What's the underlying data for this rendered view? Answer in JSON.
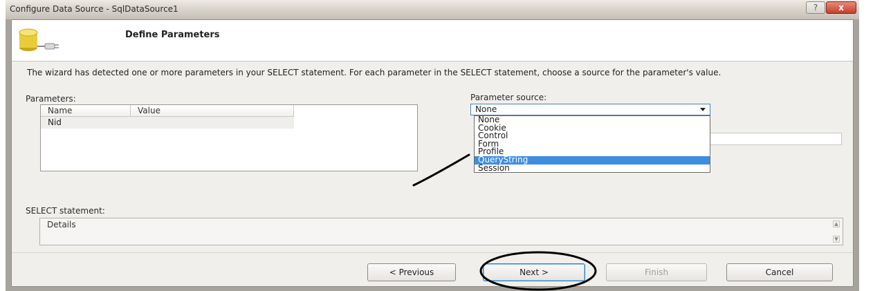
{
  "window": {
    "title": "Configure Data Source - SqlDataSource1",
    "help_glyph": "?",
    "close_glyph": "x"
  },
  "header": {
    "title": "Define Parameters",
    "icon": "database-icon"
  },
  "intro_text": "The wizard has detected one or more parameters in your SELECT statement. For each parameter in the SELECT statement, choose a source for the parameter's value.",
  "parameters": {
    "label": "Parameters:",
    "columns": [
      "Name",
      "Value"
    ],
    "rows": [
      {
        "name": "Nid",
        "value": ""
      }
    ]
  },
  "parameter_source": {
    "label": "Parameter source:",
    "selected": "None",
    "options": [
      "None",
      "Cookie",
      "Control",
      "Form",
      "Profile",
      "QueryString",
      "Session"
    ],
    "highlighted": "QueryString"
  },
  "select_statement": {
    "label": "SELECT statement:",
    "text": "Details"
  },
  "buttons": {
    "previous": "< Previous",
    "next": "Next >",
    "finish": "Finish",
    "cancel": "Cancel"
  },
  "colors": {
    "highlight": "#3d8de0",
    "annotation": "#000000"
  }
}
